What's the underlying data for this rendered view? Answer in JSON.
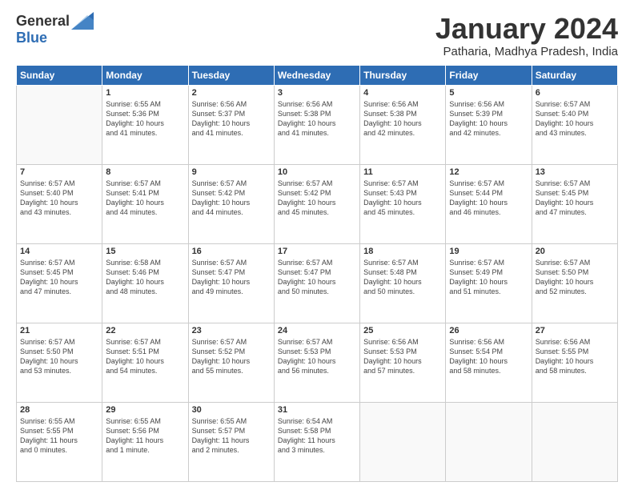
{
  "header": {
    "logo_general": "General",
    "logo_blue": "Blue",
    "month": "January 2024",
    "location": "Patharia, Madhya Pradesh, India"
  },
  "weekdays": [
    "Sunday",
    "Monday",
    "Tuesday",
    "Wednesday",
    "Thursday",
    "Friday",
    "Saturday"
  ],
  "weeks": [
    [
      {
        "day": "",
        "content": ""
      },
      {
        "day": "1",
        "content": "Sunrise: 6:55 AM\nSunset: 5:36 PM\nDaylight: 10 hours\nand 41 minutes."
      },
      {
        "day": "2",
        "content": "Sunrise: 6:56 AM\nSunset: 5:37 PM\nDaylight: 10 hours\nand 41 minutes."
      },
      {
        "day": "3",
        "content": "Sunrise: 6:56 AM\nSunset: 5:38 PM\nDaylight: 10 hours\nand 41 minutes."
      },
      {
        "day": "4",
        "content": "Sunrise: 6:56 AM\nSunset: 5:38 PM\nDaylight: 10 hours\nand 42 minutes."
      },
      {
        "day": "5",
        "content": "Sunrise: 6:56 AM\nSunset: 5:39 PM\nDaylight: 10 hours\nand 42 minutes."
      },
      {
        "day": "6",
        "content": "Sunrise: 6:57 AM\nSunset: 5:40 PM\nDaylight: 10 hours\nand 43 minutes."
      }
    ],
    [
      {
        "day": "7",
        "content": "Sunrise: 6:57 AM\nSunset: 5:40 PM\nDaylight: 10 hours\nand 43 minutes."
      },
      {
        "day": "8",
        "content": "Sunrise: 6:57 AM\nSunset: 5:41 PM\nDaylight: 10 hours\nand 44 minutes."
      },
      {
        "day": "9",
        "content": "Sunrise: 6:57 AM\nSunset: 5:42 PM\nDaylight: 10 hours\nand 44 minutes."
      },
      {
        "day": "10",
        "content": "Sunrise: 6:57 AM\nSunset: 5:42 PM\nDaylight: 10 hours\nand 45 minutes."
      },
      {
        "day": "11",
        "content": "Sunrise: 6:57 AM\nSunset: 5:43 PM\nDaylight: 10 hours\nand 45 minutes."
      },
      {
        "day": "12",
        "content": "Sunrise: 6:57 AM\nSunset: 5:44 PM\nDaylight: 10 hours\nand 46 minutes."
      },
      {
        "day": "13",
        "content": "Sunrise: 6:57 AM\nSunset: 5:45 PM\nDaylight: 10 hours\nand 47 minutes."
      }
    ],
    [
      {
        "day": "14",
        "content": "Sunrise: 6:57 AM\nSunset: 5:45 PM\nDaylight: 10 hours\nand 47 minutes."
      },
      {
        "day": "15",
        "content": "Sunrise: 6:58 AM\nSunset: 5:46 PM\nDaylight: 10 hours\nand 48 minutes."
      },
      {
        "day": "16",
        "content": "Sunrise: 6:57 AM\nSunset: 5:47 PM\nDaylight: 10 hours\nand 49 minutes."
      },
      {
        "day": "17",
        "content": "Sunrise: 6:57 AM\nSunset: 5:47 PM\nDaylight: 10 hours\nand 50 minutes."
      },
      {
        "day": "18",
        "content": "Sunrise: 6:57 AM\nSunset: 5:48 PM\nDaylight: 10 hours\nand 50 minutes."
      },
      {
        "day": "19",
        "content": "Sunrise: 6:57 AM\nSunset: 5:49 PM\nDaylight: 10 hours\nand 51 minutes."
      },
      {
        "day": "20",
        "content": "Sunrise: 6:57 AM\nSunset: 5:50 PM\nDaylight: 10 hours\nand 52 minutes."
      }
    ],
    [
      {
        "day": "21",
        "content": "Sunrise: 6:57 AM\nSunset: 5:50 PM\nDaylight: 10 hours\nand 53 minutes."
      },
      {
        "day": "22",
        "content": "Sunrise: 6:57 AM\nSunset: 5:51 PM\nDaylight: 10 hours\nand 54 minutes."
      },
      {
        "day": "23",
        "content": "Sunrise: 6:57 AM\nSunset: 5:52 PM\nDaylight: 10 hours\nand 55 minutes."
      },
      {
        "day": "24",
        "content": "Sunrise: 6:57 AM\nSunset: 5:53 PM\nDaylight: 10 hours\nand 56 minutes."
      },
      {
        "day": "25",
        "content": "Sunrise: 6:56 AM\nSunset: 5:53 PM\nDaylight: 10 hours\nand 57 minutes."
      },
      {
        "day": "26",
        "content": "Sunrise: 6:56 AM\nSunset: 5:54 PM\nDaylight: 10 hours\nand 58 minutes."
      },
      {
        "day": "27",
        "content": "Sunrise: 6:56 AM\nSunset: 5:55 PM\nDaylight: 10 hours\nand 58 minutes."
      }
    ],
    [
      {
        "day": "28",
        "content": "Sunrise: 6:55 AM\nSunset: 5:55 PM\nDaylight: 11 hours\nand 0 minutes."
      },
      {
        "day": "29",
        "content": "Sunrise: 6:55 AM\nSunset: 5:56 PM\nDaylight: 11 hours\nand 1 minute."
      },
      {
        "day": "30",
        "content": "Sunrise: 6:55 AM\nSunset: 5:57 PM\nDaylight: 11 hours\nand 2 minutes."
      },
      {
        "day": "31",
        "content": "Sunrise: 6:54 AM\nSunset: 5:58 PM\nDaylight: 11 hours\nand 3 minutes."
      },
      {
        "day": "",
        "content": ""
      },
      {
        "day": "",
        "content": ""
      },
      {
        "day": "",
        "content": ""
      }
    ]
  ]
}
